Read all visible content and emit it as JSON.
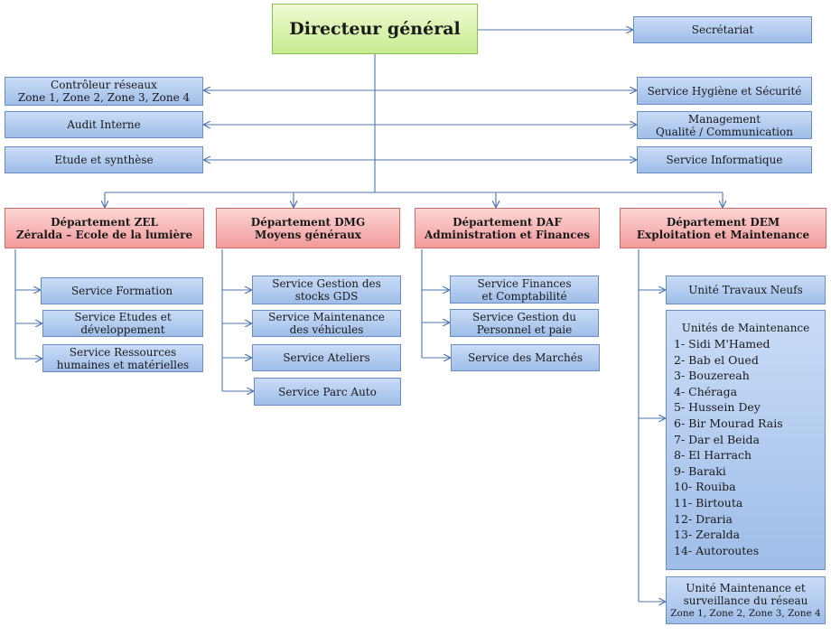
{
  "director": "Directeur général",
  "staff_left": [
    {
      "l1": "Contrôleur réseaux",
      "l2": "Zone 1, Zone 2, Zone 3, Zone 4"
    },
    {
      "l1": "Audit Interne"
    },
    {
      "l1": "Etude et synthèse"
    }
  ],
  "staff_right": [
    {
      "l1": "Secrétariat"
    },
    {
      "l1": "Service Hygiène et Sécurité"
    },
    {
      "l1": "Management",
      "l2": "Qualité / Communication"
    },
    {
      "l1": "Service Informatique"
    }
  ],
  "departments": [
    {
      "l1": "Département  ZEL",
      "l2": "Zéralda – Ecole de la lumière",
      "services": [
        {
          "l1": "Service Formation"
        },
        {
          "l1": "Service Etudes et",
          "l2": "développement"
        },
        {
          "l1": "Service Ressources",
          "l2": "humaines et matérielles"
        }
      ]
    },
    {
      "l1": "Département DMG",
      "l2": "Moyens généraux",
      "services": [
        {
          "l1": "Service Gestion des",
          "l2": "stocks GDS"
        },
        {
          "l1": "Service Maintenance",
          "l2": "des véhicules"
        },
        {
          "l1": "Service Ateliers"
        },
        {
          "l1": "Service Parc Auto"
        }
      ]
    },
    {
      "l1": "Département DAF",
      "l2": "Administration et Finances",
      "services": [
        {
          "l1": "Service Finances",
          "l2": "et Comptabilité"
        },
        {
          "l1": "Service Gestion du",
          "l2": "Personnel et paie"
        },
        {
          "l1": "Service des Marchés"
        }
      ]
    },
    {
      "l1": "Département DEM",
      "l2": "Exploitation et Maintenance",
      "services": [
        {
          "l1": "Unité Travaux Neufs"
        }
      ],
      "maintenance_title": "Unités de Maintenance",
      "maintenance_units": [
        "1- Sidi M'Hamed",
        "2- Bab el Oued",
        "3- Bouzereah",
        "4- Chéraga",
        "5- Hussein Dey",
        "6- Bir Mourad Rais",
        "7- Dar el Beida",
        "8- El Harrach",
        "9- Baraki",
        "10- Rouiba",
        "11- Birtouta",
        "12- Draria",
        "13- Zeralda",
        "14- Autoroutes"
      ],
      "network_unit": {
        "l1": "Unité Maintenance et",
        "l2": "surveillance du réseau",
        "l3": "Zone 1, Zone 2, Zone 3, Zone 4"
      }
    }
  ]
}
